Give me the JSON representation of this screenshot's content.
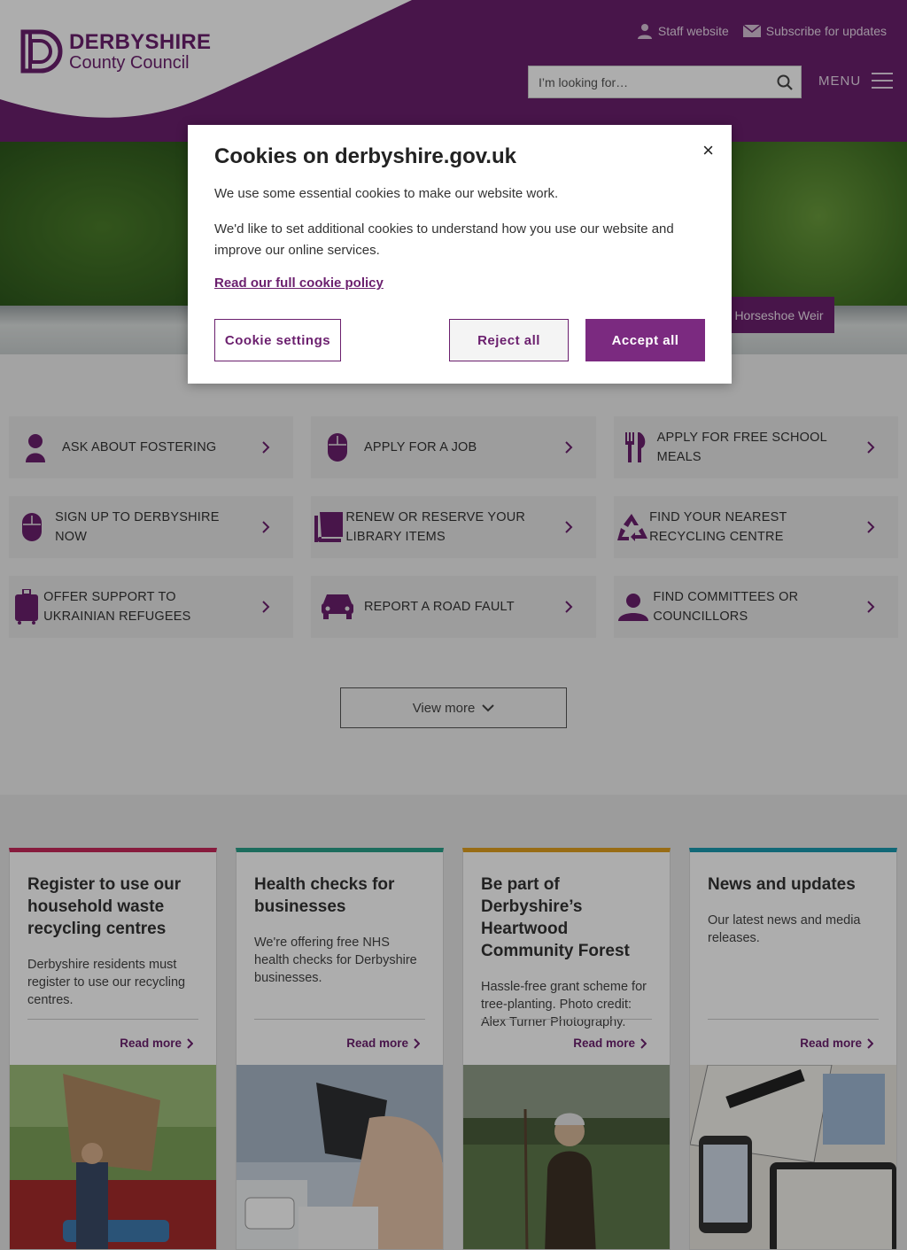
{
  "header": {
    "logo_title": "DERBYSHIRE",
    "logo_subtitle": "County Council",
    "staff_link": "Staff website",
    "subscribe_link": "Subscribe for updates",
    "search_placeholder": "I’m looking for…",
    "menu_label": "MENU"
  },
  "hero": {
    "caption": "Horseshoe Weir"
  },
  "quick_links": [
    {
      "label": "ASK ABOUT FOSTERING",
      "icon": "person-icon"
    },
    {
      "label": "APPLY FOR A JOB",
      "icon": "mouse-icon"
    },
    {
      "label": "APPLY FOR FREE SCHOOL MEALS",
      "icon": "cutlery-icon"
    },
    {
      "label": "SIGN UP TO DERBYSHIRE NOW",
      "icon": "mouse-icon"
    },
    {
      "label": "RENEW OR RESERVE YOUR LIBRARY ITEMS",
      "icon": "book-icon"
    },
    {
      "label": "FIND YOUR NEAREST RECYCLING CENTRE",
      "icon": "recycle-icon"
    },
    {
      "label": "OFFER SUPPORT TO UKRAINIAN REFUGEES",
      "icon": "suitcase-icon"
    },
    {
      "label": "REPORT A ROAD FAULT",
      "icon": "car-icon"
    },
    {
      "label": "FIND COMMITTEES OR COUNCILLORS",
      "icon": "user-icon"
    }
  ],
  "view_more": "View more",
  "cards": [
    {
      "title": "Register to use our household waste recycling centres",
      "desc": "Derbyshire residents must register to use our recycling centres.",
      "read_more": "Read more",
      "accent": "#c8285a"
    },
    {
      "title": "Health checks for businesses",
      "desc": "We're offering free NHS health checks for Derbyshire businesses.",
      "read_more": "Read more",
      "accent": "#2aa08a"
    },
    {
      "title": "Be part of Derbyshire’s Heartwood Community Forest",
      "desc": "Hassle-free grant scheme for tree-planting. Photo credit: Alex Turner Photography.",
      "read_more": "Read more",
      "accent": "#e0a020"
    },
    {
      "title": "News and updates",
      "desc": "Our latest news and media releases.",
      "read_more": "Read more",
      "accent": "#1a9ab0"
    }
  ],
  "cookie": {
    "title": "Cookies on derbyshire.gov.uk",
    "p1": "We use some essential cookies to make our website work.",
    "p2": "We'd like to set additional cookies to understand how you use our website and improve our online services.",
    "policy_link": "Read our full cookie policy",
    "settings": "Cookie settings",
    "reject": "Reject all",
    "accept": "Accept all",
    "close": "×"
  },
  "colors": {
    "brand": "#6b1f6e",
    "accept": "#7b2a80"
  }
}
